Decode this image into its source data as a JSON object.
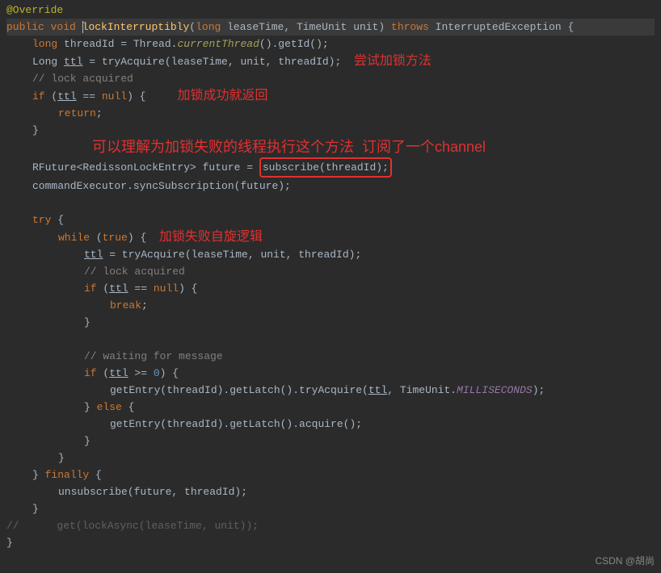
{
  "code": {
    "override": "@Override",
    "kw_public": "public",
    "kw_void": "void",
    "method_name": "lockInterruptibly",
    "sig_long": "long",
    "param1": "leaseTime",
    "type_tu": "TimeUnit",
    "param2": "unit",
    "kw_throws": "throws",
    "exception": "InterruptedException",
    "brace_o": "{",
    "brace_c": "}",
    "l3_kw": "long",
    "l3_var": "threadId = Thread.",
    "l3_static": "currentThread",
    "l3_tail": "().getId();",
    "l4_type": "Long ",
    "l4_ttl": "ttl",
    "l4_mid": " = tryAcquire(leaseTime, unit, threadId);",
    "l5_comment": "// lock acquired",
    "l6_if": "if",
    "l6_cond_o": " (",
    "l6_ttl": "ttl",
    "l6_eq": " == ",
    "l6_null": "null",
    "l6_cond_c": ") {",
    "l7_return": "return",
    "l7_semi": ";",
    "future_type": "RFuture<RedissonLockEntry> future = ",
    "subscribe_call": "subscribe(threadId);",
    "sync_line": "commandExecutor.syncSubscription(future);",
    "try_kw": "try",
    "while_kw": "while",
    "true_kw": "true",
    "while_close": ") {",
    "ttl_assign": "ttl",
    "ttl_assign_tail": " = tryAcquire(leaseTime, unit, threadId);",
    "lock_acq_comment": "// lock acquired",
    "break_kw": "break",
    "wait_comment": "// waiting for message",
    "ge_op": " >= ",
    "zero": "0",
    "ge_close": ") {",
    "getentry_line1_a": "getEntry(threadId).getLatch().tryAcquire(",
    "getentry_line1_ttl": "ttl",
    "getentry_line1_b": ", TimeUnit.",
    "ms_const": "MILLISECONDS",
    "getentry_line1_c": ");",
    "else_kw": "else",
    "getentry_line2": "getEntry(threadId).getLatch().acquire();",
    "finally_kw": "finally",
    "unsub": "unsubscribe(future, threadId);",
    "commented_get": "get(lockAsync(leaseTime, unit));"
  },
  "comments": {
    "c1": "尝试加锁方法",
    "c2": "加锁成功就返回",
    "c3": "可以理解为加锁失败的线程执行这个方法  订阅了一个channel",
    "c4": "加锁失败自旋逻辑"
  },
  "watermark": "CSDN @胡尚"
}
